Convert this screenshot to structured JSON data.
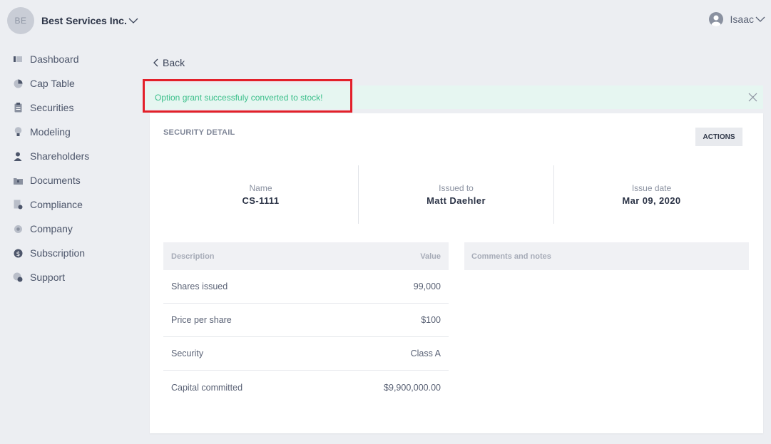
{
  "header": {
    "company_initials": "BE",
    "company_name": "Best Services Inc.",
    "user_name": "Isaac"
  },
  "sidebar": {
    "items": [
      {
        "label": "Dashboard",
        "icon": "dashboard-icon"
      },
      {
        "label": "Cap Table",
        "icon": "pie-chart-icon"
      },
      {
        "label": "Securities",
        "icon": "clipboard-icon"
      },
      {
        "label": "Modeling",
        "icon": "lightbulb-icon"
      },
      {
        "label": "Shareholders",
        "icon": "person-icon"
      },
      {
        "label": "Documents",
        "icon": "folder-icon"
      },
      {
        "label": "Compliance",
        "icon": "document-check-icon"
      },
      {
        "label": "Company",
        "icon": "gear-icon"
      },
      {
        "label": "Subscription",
        "icon": "dollar-icon"
      },
      {
        "label": "Support",
        "icon": "support-icon"
      }
    ]
  },
  "main": {
    "back_label": "Back",
    "alert_text": "Option grant successfuly converted to stock!",
    "card_title": "SECURITY DETAIL",
    "actions_label": "ACTIONS",
    "summary": [
      {
        "label": "Name",
        "value": "CS-1111"
      },
      {
        "label": "Issued to",
        "value": "Matt Daehler"
      },
      {
        "label": "Issue date",
        "value": "Mar 09, 2020"
      }
    ],
    "table": {
      "headers": [
        "Description",
        "Value"
      ],
      "rows": [
        {
          "description": "Shares issued",
          "value": "99,000"
        },
        {
          "description": "Price per share",
          "value": "$100"
        },
        {
          "description": "Security",
          "value": "Class A"
        },
        {
          "description": "Capital committed",
          "value": "$9,900,000.00"
        }
      ]
    },
    "notes_header": "Comments and notes"
  },
  "colors": {
    "alert_bg": "#e6f6f1",
    "alert_text": "#3bbf8a",
    "highlight_border": "#e3202a",
    "background": "#eceef2"
  }
}
